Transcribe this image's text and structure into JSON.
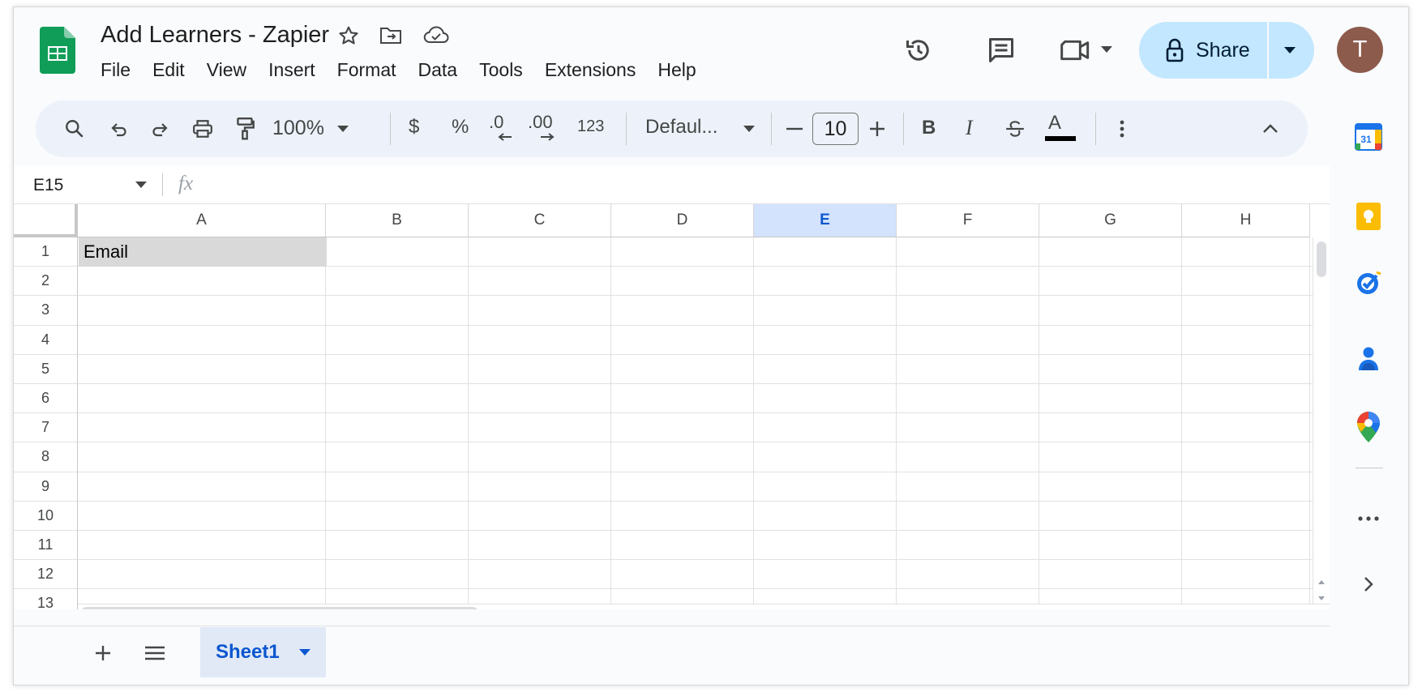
{
  "app": {
    "doc_title": "Add Learners - Zapier",
    "brand_color": "#0f9d58",
    "accent_color": "#0b57d0",
    "selected_header_color": "#d3e3fd"
  },
  "menu": [
    "File",
    "Edit",
    "View",
    "Insert",
    "Format",
    "Data",
    "Tools",
    "Extensions",
    "Help"
  ],
  "header": {
    "share_label": "Share",
    "avatar_letter": "T"
  },
  "toolbar": {
    "zoom": "100%",
    "currency": "$",
    "percent": "%",
    "decrease_decimal": ".0",
    "increase_decimal": ".00",
    "number_format": "123",
    "font": "Defaul...",
    "font_size": "10",
    "bold": "B",
    "italic": "I",
    "text_color": "A"
  },
  "formula_bar": {
    "name_box": "E15",
    "fx": "fx",
    "value": ""
  },
  "grid": {
    "columns": [
      "A",
      "B",
      "C",
      "D",
      "E",
      "F",
      "G",
      "H"
    ],
    "selected_column": "E",
    "rows": [
      "1",
      "2",
      "3",
      "4",
      "5",
      "6",
      "7",
      "8",
      "9",
      "10",
      "11",
      "12",
      "13"
    ],
    "cells": {
      "A1": "Email"
    }
  },
  "sheets": {
    "active": "Sheet1"
  },
  "side_panel": [
    "calendar-icon",
    "keep-icon",
    "tasks-icon",
    "contacts-icon",
    "maps-icon",
    "more-icon",
    "expand-icon"
  ]
}
